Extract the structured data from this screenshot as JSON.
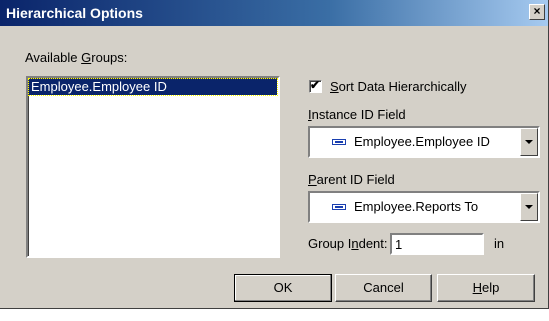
{
  "dialog": {
    "title": "Hierarchical Options",
    "close_glyph": "×"
  },
  "groups": {
    "label_pre": "Available ",
    "label_key": "G",
    "label_post": "roups:",
    "items": [
      "Employee.Employee ID"
    ]
  },
  "sort": {
    "checked": true,
    "label_key": "S",
    "label_post": "ort Data Hierarchically"
  },
  "instance": {
    "label_key": "I",
    "label_post": "nstance ID Field",
    "value": "Employee.Employee ID",
    "icon": "database-field-icon"
  },
  "parent": {
    "label_key": "P",
    "label_post": "arent ID Field",
    "value": "Employee.Reports To",
    "icon": "database-field-icon"
  },
  "indent": {
    "label_pre": "Group I",
    "label_key": "n",
    "label_post": "dent:",
    "value": "1",
    "unit": "in"
  },
  "buttons": {
    "ok": "OK",
    "cancel": "Cancel",
    "help_key": "H",
    "help_post": "elp"
  },
  "colors": {
    "title_bar": "#0a246a",
    "selection": "#0a246a",
    "face": "#d4d0c8"
  }
}
